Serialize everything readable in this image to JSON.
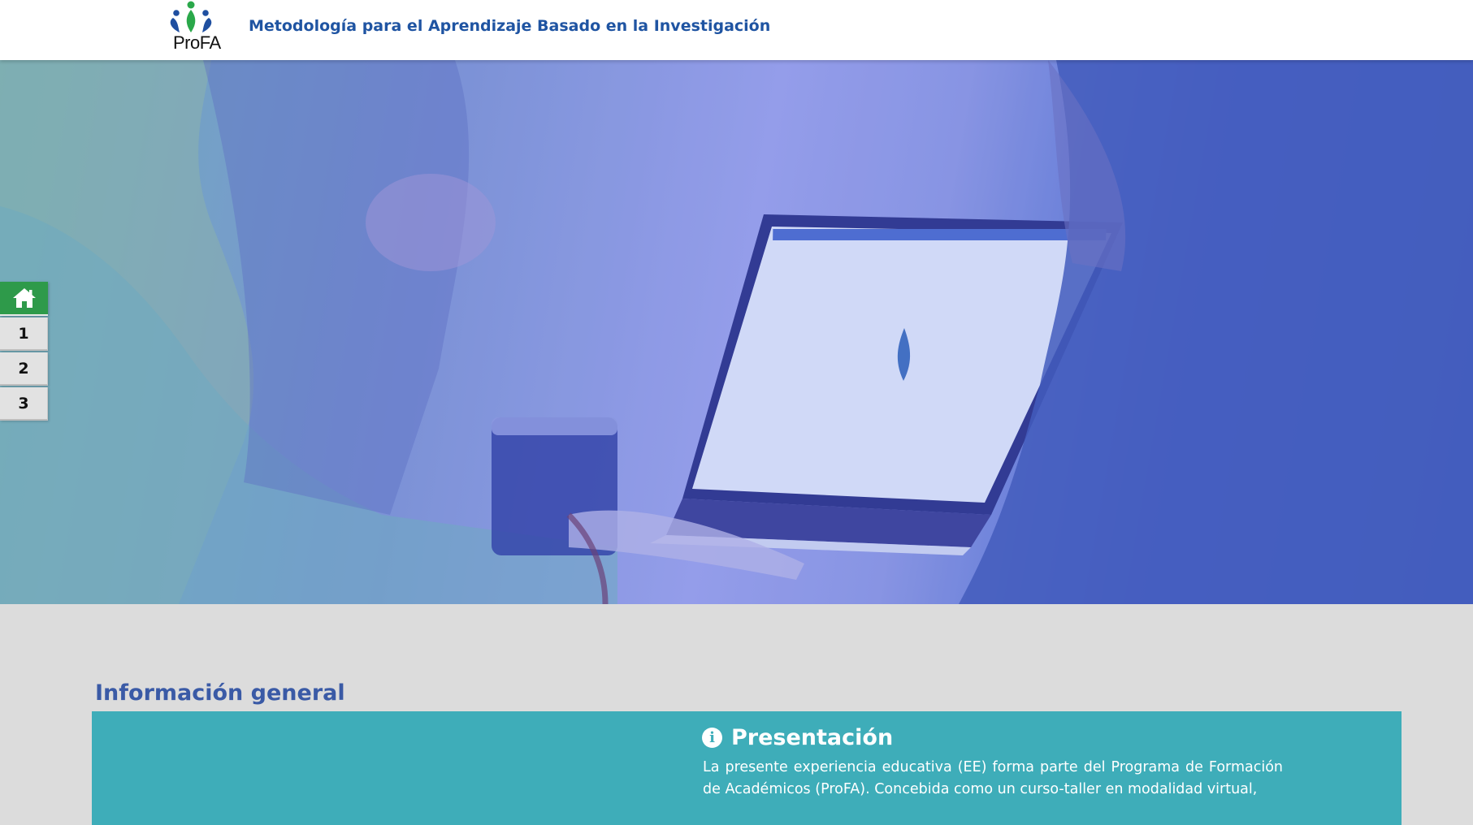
{
  "header": {
    "logo_text": "ProFA",
    "title": "Metodología para el Aprendizaje Basado en la Investigación"
  },
  "sidenav": {
    "home_icon": "home-icon",
    "items": [
      {
        "label": "1"
      },
      {
        "label": "2"
      },
      {
        "label": "3"
      }
    ]
  },
  "section": {
    "title": "Información general"
  },
  "presentation": {
    "icon": "info-icon",
    "icon_glyph": "i",
    "title": "Presentación",
    "body": "La presente experiencia educativa (EE) forma parte del Programa de Formación de Académicos (ProFA). Concebida como un curso-taller en modalidad virtual,"
  },
  "colors": {
    "header_title": "#1f54a2",
    "nav_home": "#2e9a4a",
    "section_title": "#3a5aa6",
    "card_background": "#3eadb9",
    "page_background": "#dcdcdc"
  }
}
